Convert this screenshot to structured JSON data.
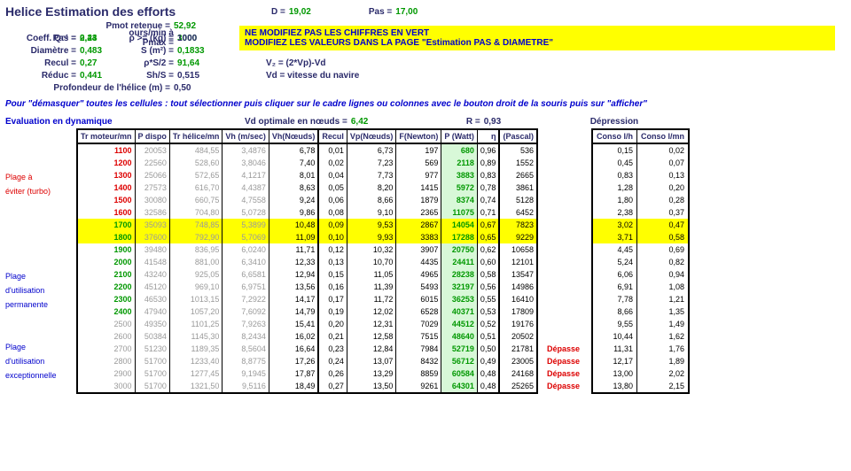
{
  "header": {
    "title": "Helice Estimation des efforts",
    "D_lbl": "D =",
    "D": "19,02",
    "Pas_lbl": "Pas =",
    "Pas_top": "17,00",
    "Pmot_lbl": "Pmot retenue =",
    "Pmot": "52,92",
    "toursPmax_lbl": "ours/min à Pmax =",
    "toursPmax": "3000",
    "pas2_lbl": "Pas =",
    "pas2": "0,43",
    "coefQ_lbl": "Coeff. Q⁻¹ =",
    "coefQ": "2,24",
    "rho_lbl": "ρ >= (kg) =",
    "rho": "1000",
    "diam_lbl": "Diamètre =",
    "diam": "0,483",
    "S_lbl": "S (m²) =",
    "S": "0,1833",
    "recul_lbl": "Recul =",
    "recul": "0,27",
    "rhoS2_lbl": "ρ*S/2 =",
    "rhoS2": "91,64",
    "V2_lbl": "V₂ = (2*Vp)-Vd",
    "reduc_lbl": "Réduc =",
    "reduc": "0,441",
    "ShS_lbl": "Sh/S =",
    "ShS": "0,515",
    "Vd_lbl": "Vd = vitesse du navire",
    "prof_lbl": "Profondeur de l'hélice (m) =",
    "prof": "0,50",
    "warn1": "NE MODIFIEZ PAS LES CHIFFRES EN VERT",
    "warn2": "MODIFIEZ LES VALEURS DANS LA PAGE \"Estimation PAS & DIAMETRE\""
  },
  "note": "Pour \"démasquer\" toutes les cellules : tout sélectionner puis cliquer sur le cadre lignes ou colonnes avec le bouton droit de la souris puis sur \"afficher\"",
  "eval": {
    "title": "Evaluation en dynamique",
    "Vd_lbl": "Vd optimale en nœuds =",
    "Vd": "6,42",
    "R_lbl": "R =",
    "R": "0,93",
    "depr_lbl": "Dépression"
  },
  "group_labels": {
    "plage_eviter_1": "Plage à",
    "plage_eviter_2": "éviter (turbo)",
    "plage_perm_1": "Plage",
    "plage_perm_2": "d'utilisation",
    "plage_perm_3": "permanente",
    "plage_exc_1": "Plage",
    "plage_exc_2": "d'utilisation",
    "plage_exc_3": "exceptionnelle"
  },
  "cols": [
    "Tr moteur/mn",
    "P dispo",
    "Tr hélice/mn",
    "Vh (m/sec)",
    "Vh(Nœuds)",
    "Recul",
    "Vp(Nœuds)",
    "F(Newton)",
    "P (Watt)",
    "η",
    "(Pascal)"
  ],
  "conso_cols": [
    "Conso l/h",
    "Conso l/mn"
  ],
  "rows": [
    {
      "tr": "1100",
      "pd": "20053",
      "th": "484,55",
      "vhms": "3,4876",
      "vhn": "6,78",
      "rec": "0,01",
      "vpn": "6,73",
      "fn": "197",
      "pw": "680",
      "eta": "0,96",
      "pa": "536",
      "clh": "0,15",
      "clm": "0,02",
      "tr_color": "red"
    },
    {
      "tr": "1200",
      "pd": "22560",
      "th": "528,60",
      "vhms": "3,8046",
      "vhn": "7,40",
      "rec": "0,02",
      "vpn": "7,23",
      "fn": "569",
      "pw": "2118",
      "eta": "0,89",
      "pa": "1552",
      "clh": "0,45",
      "clm": "0,07",
      "tr_color": "red"
    },
    {
      "tr": "1300",
      "pd": "25066",
      "th": "572,65",
      "vhms": "4,1217",
      "vhn": "8,01",
      "rec": "0,04",
      "vpn": "7,73",
      "fn": "977",
      "pw": "3883",
      "eta": "0,83",
      "pa": "2665",
      "clh": "0,83",
      "clm": "0,13",
      "tr_color": "red"
    },
    {
      "tr": "1400",
      "pd": "27573",
      "th": "616,70",
      "vhms": "4,4387",
      "vhn": "8,63",
      "rec": "0,05",
      "vpn": "8,20",
      "fn": "1415",
      "pw": "5972",
      "eta": "0,78",
      "pa": "3861",
      "clh": "1,28",
      "clm": "0,20",
      "tr_color": "red"
    },
    {
      "tr": "1500",
      "pd": "30080",
      "th": "660,75",
      "vhms": "4,7558",
      "vhn": "9,24",
      "rec": "0,06",
      "vpn": "8,66",
      "fn": "1879",
      "pw": "8374",
      "eta": "0,74",
      "pa": "5128",
      "clh": "1,80",
      "clm": "0,28",
      "tr_color": "red"
    },
    {
      "tr": "1600",
      "pd": "32586",
      "th": "704,80",
      "vhms": "5,0728",
      "vhn": "9,86",
      "rec": "0,08",
      "vpn": "9,10",
      "fn": "2365",
      "pw": "11075",
      "eta": "0,71",
      "pa": "6452",
      "clh": "2,38",
      "clm": "0,37",
      "tr_color": "red"
    },
    {
      "tr": "1700",
      "pd": "35093",
      "th": "748,85",
      "vhms": "5,3899",
      "vhn": "10,48",
      "rec": "0,09",
      "vpn": "9,53",
      "fn": "2867",
      "pw": "14054",
      "eta": "0,67",
      "pa": "7823",
      "clh": "3,02",
      "clm": "0,47",
      "tr_color": "green",
      "hl": true
    },
    {
      "tr": "1800",
      "pd": "37600",
      "th": "792,90",
      "vhms": "5,7069",
      "vhn": "11,09",
      "rec": "0,10",
      "vpn": "9,93",
      "fn": "3383",
      "pw": "17288",
      "eta": "0,65",
      "pa": "9229",
      "clh": "3,71",
      "clm": "0,58",
      "tr_color": "green",
      "hl": true
    },
    {
      "tr": "1900",
      "pd": "39480",
      "th": "836,95",
      "vhms": "6,0240",
      "vhn": "11,71",
      "rec": "0,12",
      "vpn": "10,32",
      "fn": "3907",
      "pw": "20750",
      "eta": "0,62",
      "pa": "10658",
      "clh": "4,45",
      "clm": "0,69",
      "tr_color": "green"
    },
    {
      "tr": "2000",
      "pd": "41548",
      "th": "881,00",
      "vhms": "6,3410",
      "vhn": "12,33",
      "rec": "0,13",
      "vpn": "10,70",
      "fn": "4435",
      "pw": "24411",
      "eta": "0,60",
      "pa": "12101",
      "clh": "5,24",
      "clm": "0,82",
      "tr_color": "green"
    },
    {
      "tr": "2100",
      "pd": "43240",
      "th": "925,05",
      "vhms": "6,6581",
      "vhn": "12,94",
      "rec": "0,15",
      "vpn": "11,05",
      "fn": "4965",
      "pw": "28238",
      "eta": "0,58",
      "pa": "13547",
      "clh": "6,06",
      "clm": "0,94",
      "tr_color": "green"
    },
    {
      "tr": "2200",
      "pd": "45120",
      "th": "969,10",
      "vhms": "6,9751",
      "vhn": "13,56",
      "rec": "0,16",
      "vpn": "11,39",
      "fn": "5493",
      "pw": "32197",
      "eta": "0,56",
      "pa": "14986",
      "clh": "6,91",
      "clm": "1,08",
      "tr_color": "green"
    },
    {
      "tr": "2300",
      "pd": "46530",
      "th": "1013,15",
      "vhms": "7,2922",
      "vhn": "14,17",
      "rec": "0,17",
      "vpn": "11,72",
      "fn": "6015",
      "pw": "36253",
      "eta": "0,55",
      "pa": "16410",
      "clh": "7,78",
      "clm": "1,21",
      "tr_color": "green"
    },
    {
      "tr": "2400",
      "pd": "47940",
      "th": "1057,20",
      "vhms": "7,6092",
      "vhn": "14,79",
      "rec": "0,19",
      "vpn": "12,02",
      "fn": "6528",
      "pw": "40371",
      "eta": "0,53",
      "pa": "17809",
      "clh": "8,66",
      "clm": "1,35",
      "tr_color": "green"
    },
    {
      "tr": "2500",
      "pd": "49350",
      "th": "1101,25",
      "vhms": "7,9263",
      "vhn": "15,41",
      "rec": "0,20",
      "vpn": "12,31",
      "fn": "7029",
      "pw": "44512",
      "eta": "0,52",
      "pa": "19176",
      "clh": "9,55",
      "clm": "1,49"
    },
    {
      "tr": "2600",
      "pd": "50384",
      "th": "1145,30",
      "vhms": "8,2434",
      "vhn": "16,02",
      "rec": "0,21",
      "vpn": "12,58",
      "fn": "7515",
      "pw": "48640",
      "eta": "0,51",
      "pa": "20502",
      "clh": "10,44",
      "clm": "1,62"
    },
    {
      "tr": "2700",
      "pd": "51230",
      "th": "1189,35",
      "vhms": "8,5604",
      "vhn": "16,64",
      "rec": "0,23",
      "vpn": "12,84",
      "fn": "7984",
      "pw": "52719",
      "eta": "0,50",
      "pa": "21781",
      "clh": "11,31",
      "clm": "1,76",
      "dep": "Dépasse"
    },
    {
      "tr": "2800",
      "pd": "51700",
      "th": "1233,40",
      "vhms": "8,8775",
      "vhn": "17,26",
      "rec": "0,24",
      "vpn": "13,07",
      "fn": "8432",
      "pw": "56712",
      "eta": "0,49",
      "pa": "23005",
      "clh": "12,17",
      "clm": "1,89",
      "dep": "Dépasse"
    },
    {
      "tr": "2900",
      "pd": "51700",
      "th": "1277,45",
      "vhms": "9,1945",
      "vhn": "17,87",
      "rec": "0,26",
      "vpn": "13,29",
      "fn": "8859",
      "pw": "60584",
      "eta": "0,48",
      "pa": "24168",
      "clh": "13,00",
      "clm": "2,02",
      "dep": "Dépasse"
    },
    {
      "tr": "3000",
      "pd": "51700",
      "th": "1321,50",
      "vhms": "9,5116",
      "vhn": "18,49",
      "rec": "0,27",
      "vpn": "13,50",
      "fn": "9261",
      "pw": "64301",
      "eta": "0,48",
      "pa": "25265",
      "clh": "13,80",
      "clm": "2,15",
      "dep": "Dépasse"
    }
  ]
}
